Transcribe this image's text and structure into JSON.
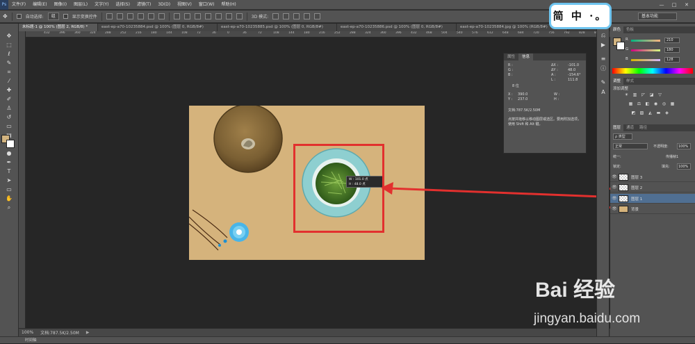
{
  "menubar": {
    "logo": "Ps",
    "items": [
      "文件(F)",
      "编辑(E)",
      "图像(I)",
      "图层(L)",
      "文字(Y)",
      "选择(S)",
      "滤镜(T)",
      "3D(D)",
      "视图(V)",
      "窗口(W)",
      "帮助(H)"
    ],
    "minimize": "—",
    "maximize": "□",
    "close": "✕"
  },
  "optionsbar": {
    "auto_select_label": "自动选择:",
    "auto_select_value": "组",
    "show_transform_label": "显示变换控件",
    "mode_3d_label": "3D 模式:",
    "workspace": "基本功能"
  },
  "tabs": [
    "未标题-1 @ 100% (图层 2, RGB/8) *",
    "east-ep-a70-10235884.psd @ 100% (图层 0, RGB/8#)",
    "east-ep-a70-10235885.psd @ 100% (图层 0, RGB/8#)",
    "east-ep-a70-10235886.psd @ 100% (图层 0, RGB/8#)",
    "east-ep-a70-10235884.jpg @ 100% (RGB/8#)"
  ],
  "ruler": [
    "432",
    "396",
    "360",
    "324",
    "288",
    "252",
    "216",
    "180",
    "144",
    "108",
    "72",
    "36",
    "0",
    "36",
    "72",
    "108",
    "144",
    "180",
    "216",
    "252",
    "288",
    "324",
    "360",
    "396",
    "432",
    "468",
    "504",
    "540",
    "576",
    "612",
    "648",
    "684",
    "720",
    "756",
    "792",
    "828",
    "864",
    "900"
  ],
  "info_panel": {
    "tabs": [
      "属性",
      "信息"
    ],
    "r": "R :",
    "g": "G :",
    "b": "B :",
    "dx_label": "ΔX :",
    "dx": "-101.0",
    "dy_label": "ΔY :",
    "dy": "48.0",
    "a_label": "A :",
    "a": "-154.6°",
    "l_label": "L :",
    "l": "111.8",
    "bit": "8 位",
    "x_label": "X :",
    "x": "390.0",
    "y_label": "Y :",
    "y": "237.0",
    "w_label": "W :",
    "h_label": "H :",
    "doc": "文档:787.5K/2.50M",
    "hint": "点按并拖移以移动图层或选区。要用附加选项，使用 Shift 和 Alt 键。"
  },
  "transform_tooltip": {
    "w": "W : 101.0 点",
    "h": "H : 48.0 点"
  },
  "status": {
    "zoom": "100%",
    "doc": "文档:787.5K/2.50M"
  },
  "timeline": "时间轴",
  "color_panel": {
    "tabs": [
      "颜色",
      "色板"
    ],
    "r_label": "R",
    "r": "210",
    "g_label": "G",
    "g": "180",
    "b_label": "B",
    "b": "128",
    "foreground": "#d2b480"
  },
  "adjustments_panel": {
    "tabs": [
      "调整",
      "样式"
    ],
    "title": "添加调整"
  },
  "layers_panel": {
    "tabs": [
      "图层",
      "通道",
      "路径"
    ],
    "kind": "ρ 类型",
    "blend": "正常",
    "opacity_label": "不透明度:",
    "opacity": "100%",
    "unify_label": "统一:",
    "propagate_label": "传播帧1",
    "lock_label": "锁定:",
    "fill_label": "填充:",
    "fill": "100%",
    "layers": [
      {
        "name": "图层 3",
        "selected": false
      },
      {
        "name": "图层 2",
        "selected": false
      },
      {
        "name": "图层 1",
        "selected": true
      },
      {
        "name": "背景",
        "selected": false
      }
    ]
  },
  "overlay": {
    "badge": "简 中 ·。"
  },
  "watermark": {
    "brand": "Bai 经验",
    "url": "jingyan.baidu.com"
  }
}
